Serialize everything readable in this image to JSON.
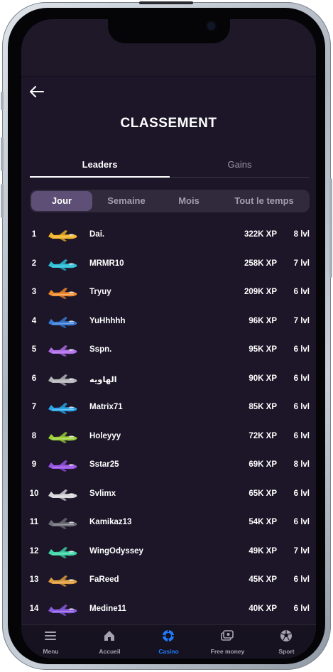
{
  "header": {
    "title": "CLASSEMENT"
  },
  "tabs": [
    {
      "label": "Leaders",
      "active": true
    },
    {
      "label": "Gains",
      "active": false
    }
  ],
  "periods": [
    {
      "label": "Jour",
      "active": true
    },
    {
      "label": "Semaine",
      "active": false
    },
    {
      "label": "Mois",
      "active": false
    },
    {
      "label": "Tout le temps",
      "active": false
    }
  ],
  "leaders": [
    {
      "rank": "1",
      "name": "Dai.",
      "xp": "322K XP",
      "level": "8 lvl",
      "plane_color": "#f2b52b"
    },
    {
      "rank": "2",
      "name": "MRMR10",
      "xp": "258K XP",
      "level": "7 lvl",
      "plane_color": "#2ec0d6"
    },
    {
      "rank": "3",
      "name": "Tryuy",
      "xp": "209K XP",
      "level": "6 lvl",
      "plane_color": "#f08a2e"
    },
    {
      "rank": "4",
      "name": "YuHhhhh",
      "xp": "96K XP",
      "level": "7 lvl",
      "plane_color": "#3a7bd5"
    },
    {
      "rank": "5",
      "name": "Sspn.",
      "xp": "95K XP",
      "level": "6 lvl",
      "plane_color": "#b06ee8"
    },
    {
      "rank": "6",
      "name": "الهاويه",
      "xp": "90K XP",
      "level": "6 lvl",
      "plane_color": "#b8b8bc"
    },
    {
      "rank": "7",
      "name": "Matrix71",
      "xp": "85K XP",
      "level": "6 lvl",
      "plane_color": "#2aa6e8"
    },
    {
      "rank": "8",
      "name": "Holeyyy",
      "xp": "72K XP",
      "level": "6 lvl",
      "plane_color": "#9ccf3a"
    },
    {
      "rank": "9",
      "name": "Sstar25",
      "xp": "69K XP",
      "level": "8 lvl",
      "plane_color": "#9a56e6"
    },
    {
      "rank": "10",
      "name": "Svlimx",
      "xp": "65K XP",
      "level": "6 lvl",
      "plane_color": "#d8d8dc"
    },
    {
      "rank": "11",
      "name": "Kamikaz13",
      "xp": "54K XP",
      "level": "6 lvl",
      "plane_color": "#6e6e78"
    },
    {
      "rank": "12",
      "name": "WingOdyssey",
      "xp": "49K XP",
      "level": "7 lvl",
      "plane_color": "#3fd6a8"
    },
    {
      "rank": "13",
      "name": "FaReed",
      "xp": "45K XP",
      "level": "6 lvl",
      "plane_color": "#e0a040"
    },
    {
      "rank": "14",
      "name": "Medine11",
      "xp": "40K XP",
      "level": "6 lvl",
      "plane_color": "#8b5ce0"
    }
  ],
  "bottom_nav": [
    {
      "label": "Menu",
      "icon": "menu-icon",
      "active": false
    },
    {
      "label": "Accueil",
      "icon": "home-icon",
      "active": false
    },
    {
      "label": "Casino",
      "icon": "casino-chip-icon",
      "active": true
    },
    {
      "label": "Free money",
      "icon": "free-money-icon",
      "active": false
    },
    {
      "label": "Sport",
      "icon": "soccer-ball-icon",
      "active": false
    }
  ],
  "colors": {
    "background": "#1c1628",
    "active_pill": "#5d4f76",
    "nav_active": "#1f7cff"
  }
}
